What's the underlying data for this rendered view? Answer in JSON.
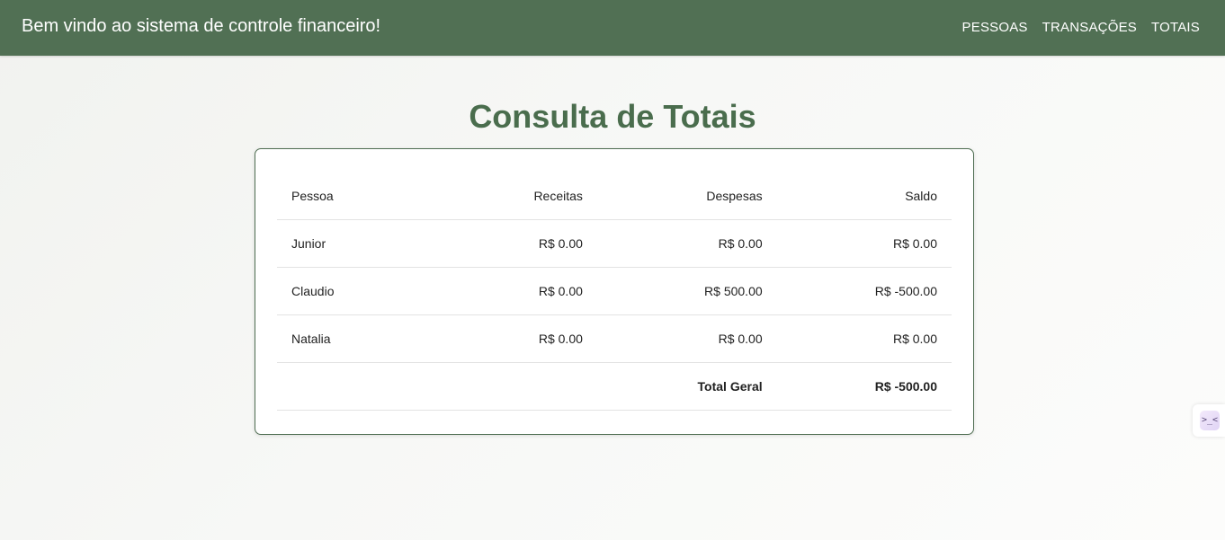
{
  "header": {
    "welcome": "Bem vindo ao sistema de controle financeiro!",
    "nav": [
      "PESSOAS",
      "TRANSAÇÕES",
      "TOTAIS"
    ]
  },
  "main": {
    "title": "Consulta de Totais",
    "table": {
      "columns": [
        "Pessoa",
        "Receitas",
        "Despesas",
        "Saldo"
      ],
      "rows": [
        [
          "Junior",
          "R$ 0.00",
          "R$ 0.00",
          "R$ 0.00"
        ],
        [
          "Claudio",
          "R$ 0.00",
          "R$ 500.00",
          "R$ -500.00"
        ],
        [
          "Natalia",
          "R$ 0.00",
          "R$ 0.00",
          "R$ 0.00"
        ]
      ],
      "total": {
        "label": "Total Geral",
        "value": "R$ -500.00"
      }
    }
  },
  "side_widget": {
    "icon": "extension-icon",
    "glyph": ">_<"
  },
  "colors": {
    "header_bg": "#517054",
    "title": "#4a6d4d",
    "card_border": "#4f6e52"
  }
}
